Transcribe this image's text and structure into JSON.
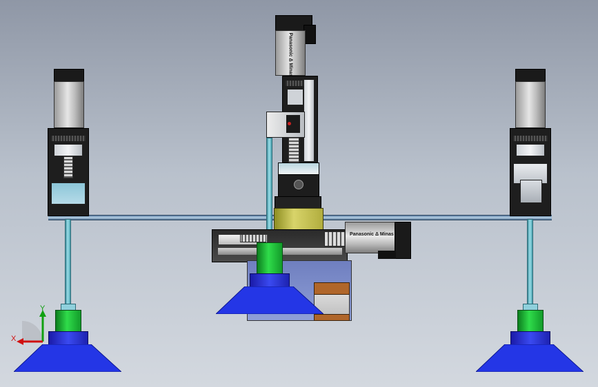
{
  "scene": {
    "motor_labels": {
      "top": "Panasonic  Δ Minas",
      "right": "Panasonic  Δ Minas"
    },
    "triad": {
      "x_label": "X",
      "y_label": "Y"
    },
    "colors": {
      "background_top": "#8f97a6",
      "background_bottom": "#d3d8df",
      "suction_cup": "#2436e6",
      "fitting": "#2fdc4a",
      "rod": "#9be0ea",
      "carriage": "#d8d46a",
      "axis_x": "#d01010",
      "axis_y": "#10a010"
    }
  }
}
